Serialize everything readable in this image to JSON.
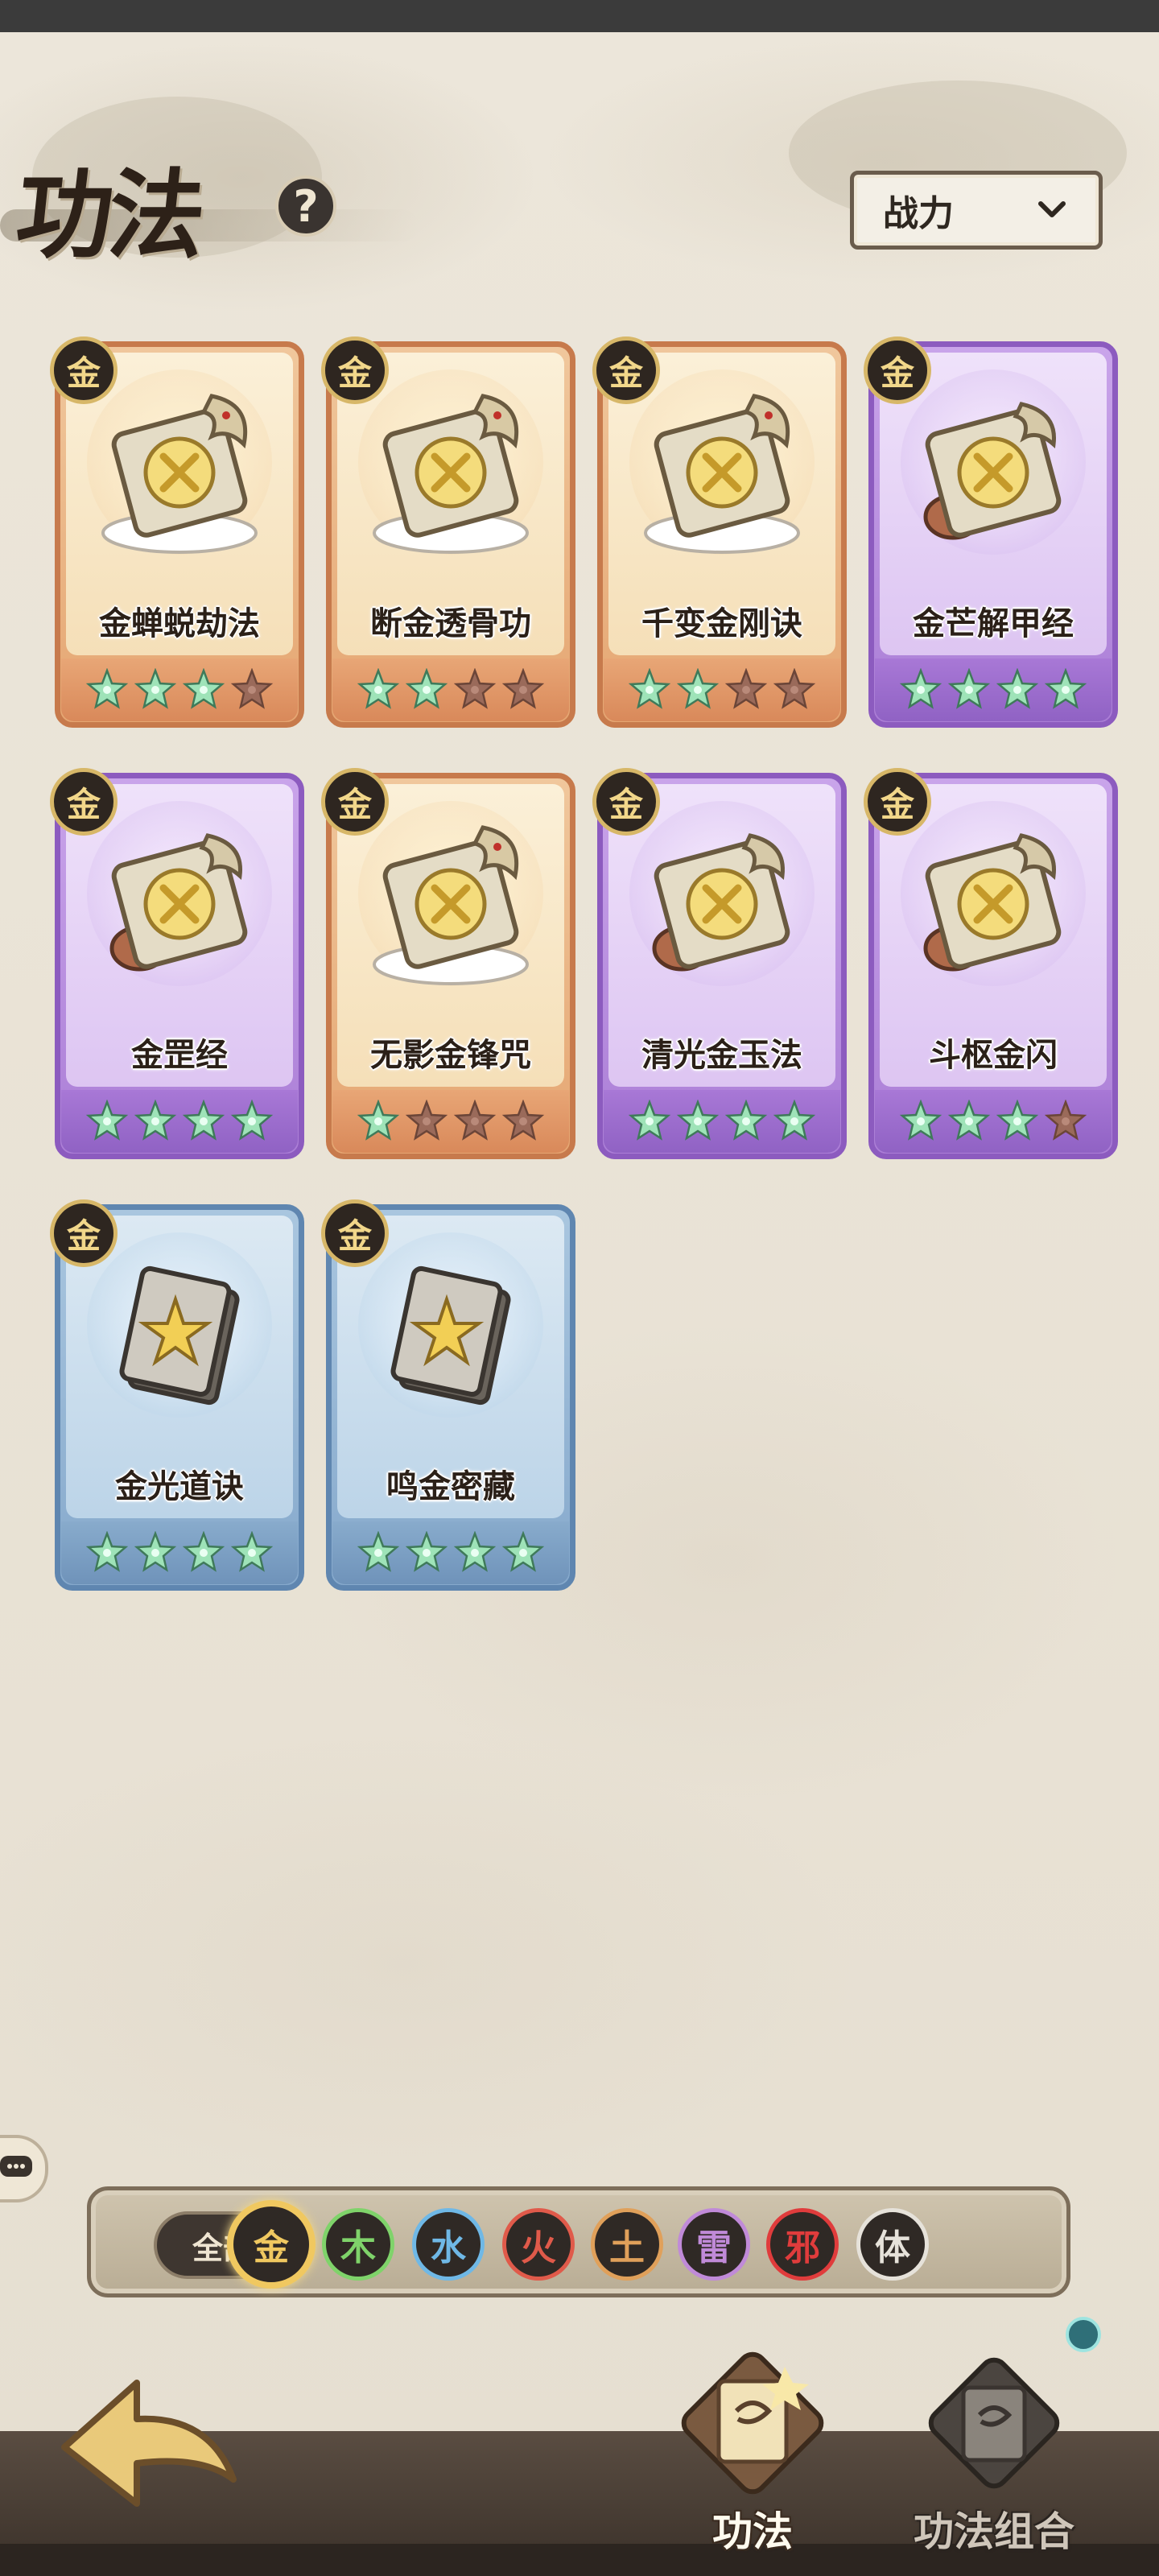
{
  "header": {
    "title": "功法",
    "help_label": "?",
    "sort": {
      "selected": "战力"
    }
  },
  "cards": [
    {
      "name": "金蝉蜕劫法",
      "element": "金",
      "rarity": "orange",
      "stars": 3,
      "max_stars": 4,
      "art": "dragon-scroll-swords-icon"
    },
    {
      "name": "断金透骨功",
      "element": "金",
      "rarity": "orange",
      "stars": 2,
      "max_stars": 4,
      "art": "dragon-scroll-shield-icon"
    },
    {
      "name": "千变金刚诀",
      "element": "金",
      "rarity": "orange",
      "stars": 2,
      "max_stars": 4,
      "art": "dragon-scroll-claw-icon"
    },
    {
      "name": "金芒解甲经",
      "element": "金",
      "rarity": "purple",
      "stars": 4,
      "max_stars": 4,
      "art": "scroll-sword-icon"
    },
    {
      "name": "金罡经",
      "element": "金",
      "rarity": "purple",
      "stars": 4,
      "max_stars": 4,
      "art": "scroll-arrows-icon"
    },
    {
      "name": "无影金锋咒",
      "element": "金",
      "rarity": "orange",
      "stars": 1,
      "max_stars": 4,
      "art": "dragon-scroll-blades-icon"
    },
    {
      "name": "清光金玉法",
      "element": "金",
      "rarity": "purple",
      "stars": 4,
      "max_stars": 4,
      "art": "scroll-orb-icon"
    },
    {
      "name": "斗枢金闪",
      "element": "金",
      "rarity": "purple",
      "stars": 3,
      "max_stars": 4,
      "art": "scroll-bow-icon"
    },
    {
      "name": "金光道诀",
      "element": "金",
      "rarity": "blue",
      "stars": 4,
      "max_stars": 4,
      "art": "book-burst-icon"
    },
    {
      "name": "鸣金密藏",
      "element": "金",
      "rarity": "blue",
      "stars": 4,
      "max_stars": 4,
      "art": "book-shield-icon"
    }
  ],
  "filters": {
    "all_label": "全部",
    "selected": "金",
    "elements": [
      {
        "label": "金",
        "color": "#f0c860"
      },
      {
        "label": "木",
        "color": "#7fd36a"
      },
      {
        "label": "水",
        "color": "#6fb8e6"
      },
      {
        "label": "火",
        "color": "#e05a4a"
      },
      {
        "label": "土",
        "color": "#e0a05a"
      },
      {
        "label": "雷",
        "color": "#c08ad8"
      },
      {
        "label": "邪",
        "color": "#e03c3c"
      },
      {
        "label": "体",
        "color": "#e6e2da"
      }
    ]
  },
  "nav": {
    "tabs": [
      {
        "label": "功法",
        "active": true
      },
      {
        "label": "功法组合",
        "active": false
      }
    ]
  },
  "colors": {
    "star_on": "#9ee3b8",
    "star_off": "#9a6a5a",
    "gold": "#d7b768"
  }
}
